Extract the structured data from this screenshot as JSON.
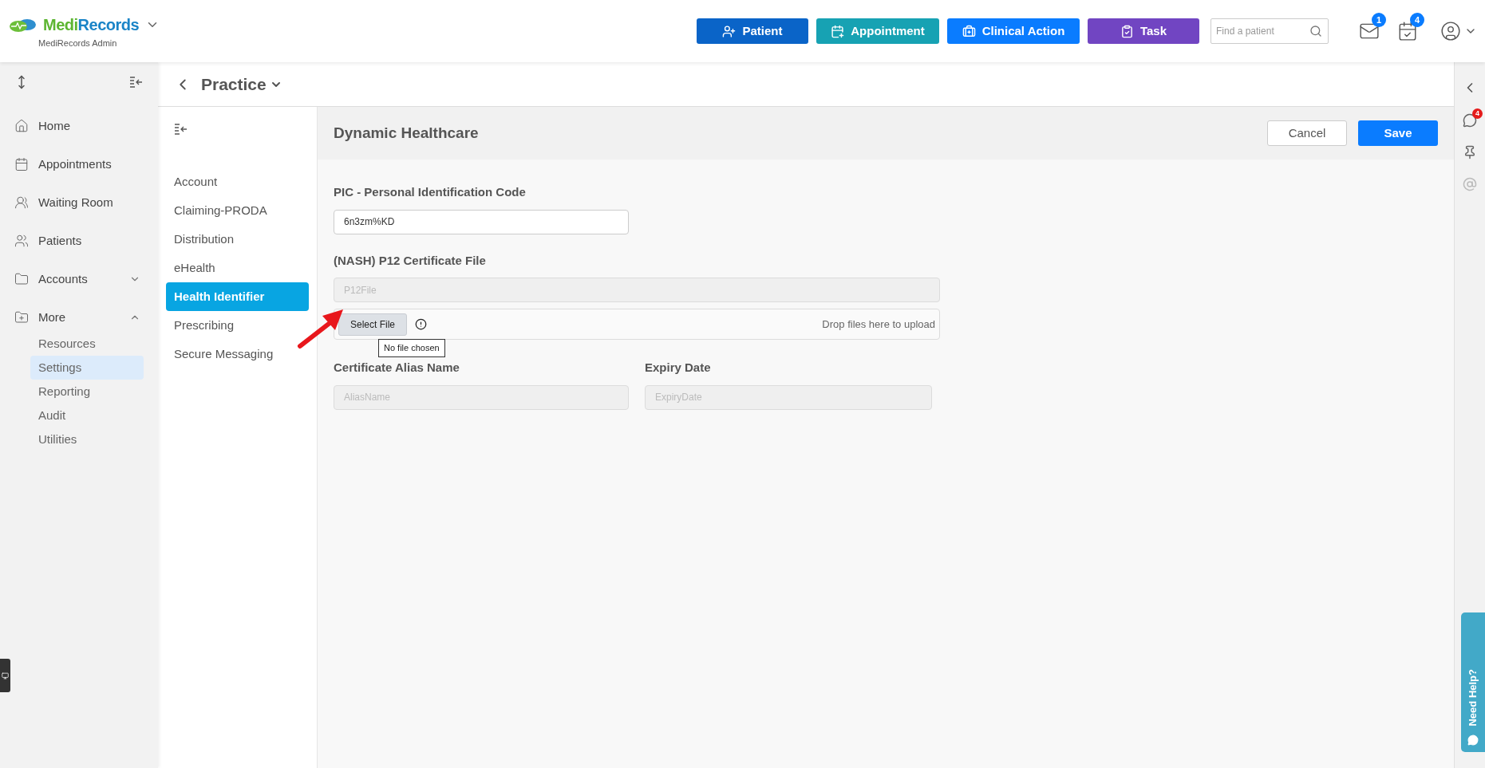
{
  "app": {
    "brand": [
      "Medi",
      "Records"
    ],
    "subtitle": "MediRecords Admin"
  },
  "actions": [
    {
      "label": "Patient",
      "kind": "patient",
      "color": "#0a64c8"
    },
    {
      "label": "Appointment",
      "kind": "appointment",
      "color": "#17a2b3"
    },
    {
      "label": "Clinical Action",
      "kind": "clinical",
      "color": "#0a7cff"
    },
    {
      "label": "Task",
      "kind": "task",
      "color": "#7145c2"
    }
  ],
  "search": {
    "placeholder": "Find a patient"
  },
  "notifications": [
    {
      "kind": "mail",
      "count": "1"
    },
    {
      "kind": "calendar",
      "count": "4"
    }
  ],
  "nav": [
    {
      "label": "Home",
      "kind": "home"
    },
    {
      "label": "Appointments",
      "kind": "calendar"
    },
    {
      "label": "Waiting Room",
      "kind": "waiting"
    },
    {
      "label": "Patients",
      "kind": "patients"
    },
    {
      "label": "Accounts",
      "kind": "folder",
      "expanded": false
    },
    {
      "label": "More",
      "kind": "folder-plus",
      "expanded": true,
      "children": [
        {
          "label": "Resources",
          "selected": false
        },
        {
          "label": "Settings",
          "selected": true
        },
        {
          "label": "Reporting",
          "selected": false
        },
        {
          "label": "Audit",
          "selected": false
        },
        {
          "label": "Utilities",
          "selected": false
        }
      ]
    }
  ],
  "breadcrumb": {
    "title": "Practice"
  },
  "settings_menu": [
    {
      "label": "Account",
      "selected": false
    },
    {
      "label": "Claiming-PRODA",
      "selected": false
    },
    {
      "label": "Distribution",
      "selected": false
    },
    {
      "label": "eHealth",
      "selected": false
    },
    {
      "label": "Health Identifier",
      "selected": true
    },
    {
      "label": "Prescribing",
      "selected": false
    },
    {
      "label": "Secure Messaging",
      "selected": false
    }
  ],
  "form": {
    "title": "Dynamic Healthcare",
    "buttons": [
      "Cancel",
      "Save"
    ],
    "pic": {
      "label": "PIC - Personal Identification Code",
      "value": "6n3zm%KD"
    },
    "certificate": {
      "label": "(NASH) P12 Certificate File",
      "placeholder": "P12File",
      "select_button": "Select File",
      "drop_hint": "Drop files here to upload",
      "tooltip": "No file chosen"
    },
    "alias": {
      "label": "Certificate Alias Name",
      "placeholder": "AliasName"
    },
    "expiry": {
      "label": "Expiry Date",
      "placeholder": "ExpiryDate"
    }
  },
  "right_rail": {
    "chat_count": "4",
    "help_label": "Need Help?"
  }
}
